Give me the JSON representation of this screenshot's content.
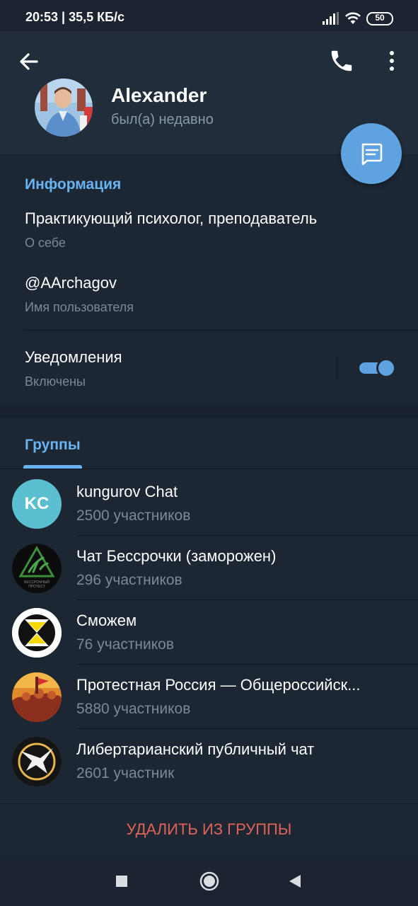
{
  "status_bar": {
    "time_speed": "20:53 | 35,5 КБ/с",
    "battery": "50"
  },
  "header": {
    "name": "Alexander",
    "status": "был(а) недавно"
  },
  "info": {
    "section_title": "Информация",
    "bio": "Практикующий психолог, преподаватель",
    "bio_label": "О себе",
    "username": "@AArchagov",
    "username_label": "Имя пользователя",
    "notifications": "Уведомления",
    "notifications_state": "Включены",
    "notifications_on": true
  },
  "groups": {
    "tab_label": "Группы",
    "items": [
      {
        "avatar_text": "KC",
        "title": "kungurov Chat",
        "members": "2500 участников"
      },
      {
        "avatar_text": "БЕССРОЧНЫЙ ПРОТЕСТ",
        "title": "Чат Бессрочки (заморожен)",
        "members": "296 участников"
      },
      {
        "avatar_text": "",
        "title": "Сможем",
        "members": "76 участников"
      },
      {
        "avatar_text": "",
        "title": "Протестная Россия — Общероссийск...",
        "members": "5880 участников"
      },
      {
        "avatar_text": "",
        "title": "Либертарианский публичный чат",
        "members": "2601 участник"
      }
    ]
  },
  "actions": {
    "remove_label": "УДАЛИТЬ ИЗ ГРУППЫ"
  },
  "colors": {
    "accent": "#6ab3f3",
    "fab": "#5ea3e0",
    "danger": "#e0635a",
    "background": "#1d2733",
    "header": "#212d3b"
  },
  "icons": {
    "back": "arrow-left-icon",
    "call": "phone-icon",
    "more": "more-vertical-icon",
    "fab": "message-icon",
    "nav_recents": "square-icon",
    "nav_home": "circle-icon",
    "nav_back": "triangle-back-icon"
  }
}
